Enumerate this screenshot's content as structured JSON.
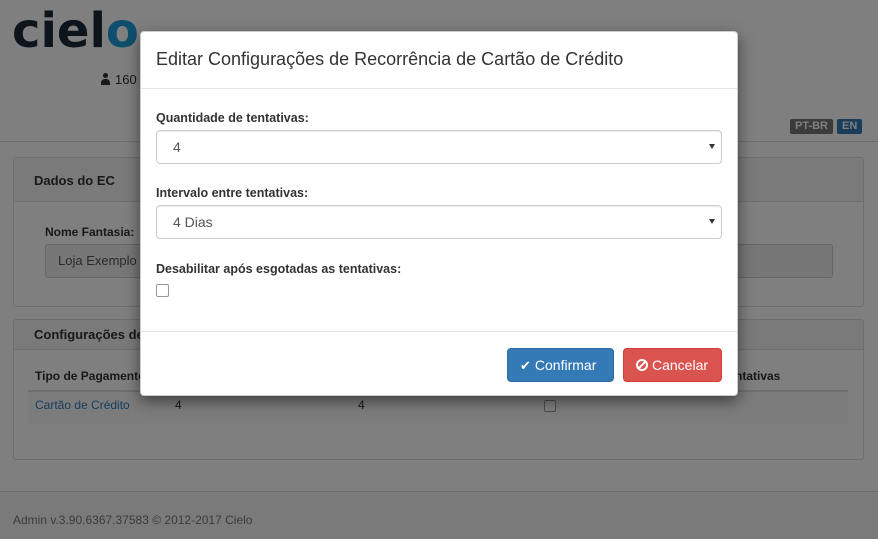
{
  "background": {
    "logo": {
      "text_main": "ciel",
      "text_accent": "o"
    },
    "user": {
      "text": "160"
    },
    "languages": [
      "PT-BR",
      "EN"
    ],
    "panel1": {
      "title": "Dados do EC",
      "field_label": "Nome Fantasia:",
      "field_value": "Loja Exemplo"
    },
    "panel2": {
      "title": "Configurações de",
      "col_tipo": "Tipo de Pagamento",
      "col_tentativas": "ntativas",
      "row": {
        "tipo": "Cartão de Crédito",
        "qtd": "4",
        "intervalo": "4"
      }
    },
    "footer": "Admin v.3.90.6367.37583 © 2012-2017 Cielo"
  },
  "modal": {
    "title": "Editar Configurações de Recorrência de Cartão de Crédito",
    "fields": {
      "quantidade_label": "Quantidade de tentativas:",
      "quantidade_value": "4",
      "intervalo_label": "Intervalo entre tentativas:",
      "intervalo_value": "4 Dias",
      "desabilitar_label": "Desabilitar após esgotadas as tentativas:"
    },
    "buttons": {
      "confirm": "Confirmar",
      "cancel": "Cancelar"
    }
  },
  "colors": {
    "primary": "#337ab7",
    "danger": "#d9534f",
    "logo_accent": "#1a9ed9"
  }
}
